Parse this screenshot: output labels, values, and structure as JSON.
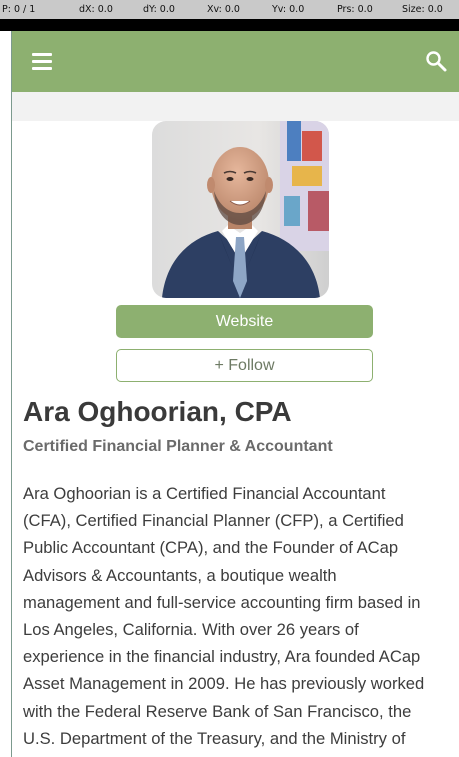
{
  "debug_overlay": {
    "pointer": "P: 0 / 1",
    "dx": "dX: 0.0",
    "dy": "dY: 0.0",
    "xv": "Xv: 0.0",
    "yv": "Yv: 0.0",
    "prs": "Prs: 0.0",
    "size": "Size: 0.0"
  },
  "app_bar": {
    "menu_icon": "hamburger-menu-icon",
    "search_icon": "search-icon",
    "color": "#8db070"
  },
  "profile": {
    "photo": "profile-photo",
    "website_button": "Website",
    "follow_button": "+ Follow",
    "name": "Ara Oghoorian, CPA",
    "title": "Certified Financial Planner & Accountant",
    "bio_lines": [
      "Ara Oghoorian is a Certified Financial Accountant",
      "(CFA), Certified Financial Planner (CFP), a Certified",
      "Public Accountant (CPA), and the Founder of ACap",
      "Advisors & Accountants, a boutique wealth",
      "management and full-service accounting firm based in",
      "Los Angeles, California. With over 26 years of",
      "experience in the financial industry, Ara founded ACap",
      "Asset Management in 2009. He has previously worked",
      "with the Federal Reserve Bank of San Francisco, the",
      "U.S. Department of the Treasury, and the Ministry of"
    ]
  }
}
